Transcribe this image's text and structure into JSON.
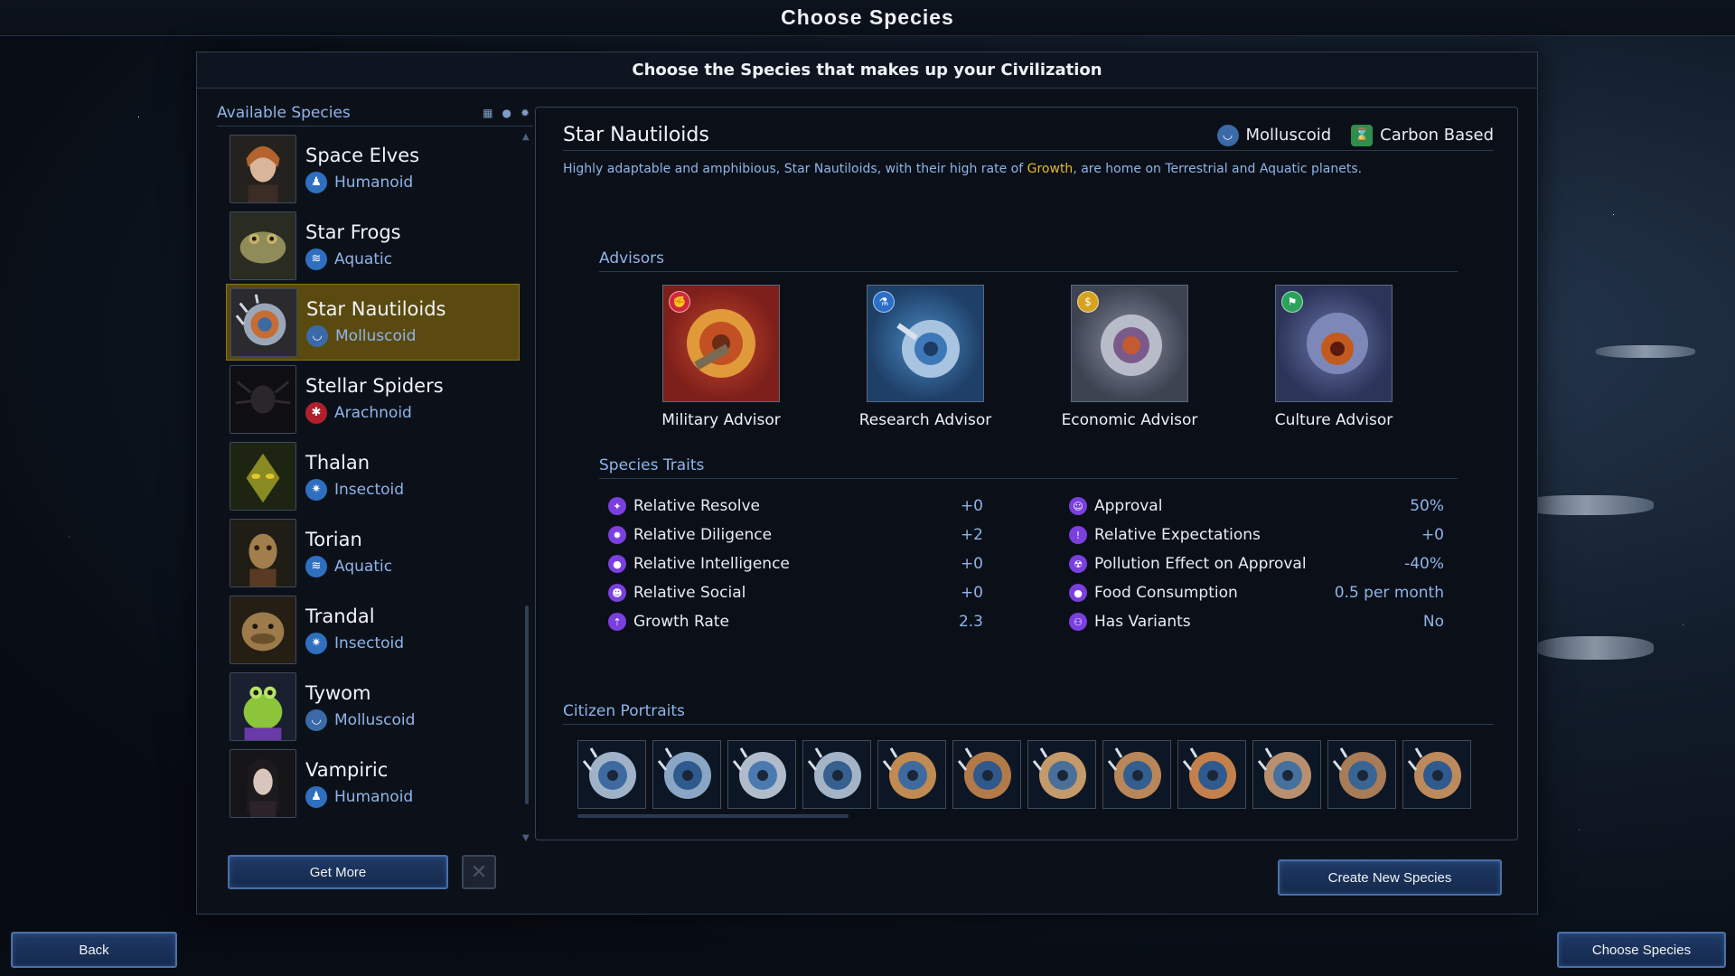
{
  "header": {
    "title": "Choose Species"
  },
  "window": {
    "subtitle": "Choose the Species that makes up your Civilization"
  },
  "species_list": {
    "title": "Available Species",
    "tools": [
      "grid-icon",
      "person-icon",
      "gear-icon"
    ],
    "items": [
      {
        "name": "Space Elves",
        "type": "Humanoid",
        "type_icon": "humanoid-icon",
        "selected": false
      },
      {
        "name": "Star Frogs",
        "type": "Aquatic",
        "type_icon": "aquatic-icon",
        "selected": false
      },
      {
        "name": "Star Nautiloids",
        "type": "Molluscoid",
        "type_icon": "molluscoid-icon",
        "selected": true
      },
      {
        "name": "Stellar Spiders",
        "type": "Arachnoid",
        "type_icon": "arachnoid-icon",
        "selected": false
      },
      {
        "name": "Thalan",
        "type": "Insectoid",
        "type_icon": "insectoid-icon",
        "selected": false
      },
      {
        "name": "Torian",
        "type": "Aquatic",
        "type_icon": "aquatic-icon",
        "selected": false
      },
      {
        "name": "Trandal",
        "type": "Insectoid",
        "type_icon": "insectoid-icon",
        "selected": false
      },
      {
        "name": "Tywom",
        "type": "Molluscoid",
        "type_icon": "molluscoid-icon",
        "selected": false
      },
      {
        "name": "Vampiric",
        "type": "Humanoid",
        "type_icon": "humanoid-icon",
        "selected": false
      }
    ],
    "get_more_label": "Get More"
  },
  "detail": {
    "name": "Star Nautiloids",
    "tags": [
      {
        "label": "Molluscoid",
        "icon": "molluscoid-icon"
      },
      {
        "label": "Carbon Based",
        "icon": "carbon-based-icon"
      }
    ],
    "description_pre": "Highly adaptable and amphibious, Star Nautiloids, with their high rate of ",
    "description_highlight": "Growth",
    "description_post": ", are home on Terrestrial and Aquatic planets.",
    "advisors_title": "Advisors",
    "advisors": [
      {
        "label": "Military Advisor",
        "badge_icon": "military-icon"
      },
      {
        "label": "Research Advisor",
        "badge_icon": "research-icon"
      },
      {
        "label": "Economic Advisor",
        "badge_icon": "economic-icon"
      },
      {
        "label": "Culture Advisor",
        "badge_icon": "culture-icon"
      }
    ],
    "traits_title": "Species Traits",
    "traits_left": [
      {
        "label": "Relative Resolve",
        "value": "+0",
        "icon": "resolve-icon"
      },
      {
        "label": "Relative Diligence",
        "value": "+2",
        "icon": "diligence-icon"
      },
      {
        "label": "Relative Intelligence",
        "value": "+0",
        "icon": "intelligence-icon"
      },
      {
        "label": "Relative Social",
        "value": "+0",
        "icon": "social-icon"
      },
      {
        "label": "Growth Rate",
        "value": "2.3",
        "icon": "growth-icon"
      }
    ],
    "traits_right": [
      {
        "label": "Approval",
        "value": "50%",
        "icon": "approval-icon"
      },
      {
        "label": "Relative Expectations",
        "value": "+0",
        "icon": "expectations-icon"
      },
      {
        "label": "Pollution Effect on Approval",
        "value": "-40%",
        "icon": "pollution-icon"
      },
      {
        "label": "Food Consumption",
        "value": "0.5 per month",
        "icon": "food-icon"
      },
      {
        "label": "Has Variants",
        "value": "No",
        "icon": "variants-icon"
      }
    ],
    "portraits_title": "Citizen Portraits",
    "create_new_label": "Create New Species"
  },
  "footer": {
    "back_label": "Back",
    "choose_label": "Choose Species"
  },
  "colors": {
    "accent": "#8fb4e8",
    "selected": "#5a4a0f",
    "highlight": "#e5b92a",
    "trait_icon": "#7b3fe0"
  }
}
